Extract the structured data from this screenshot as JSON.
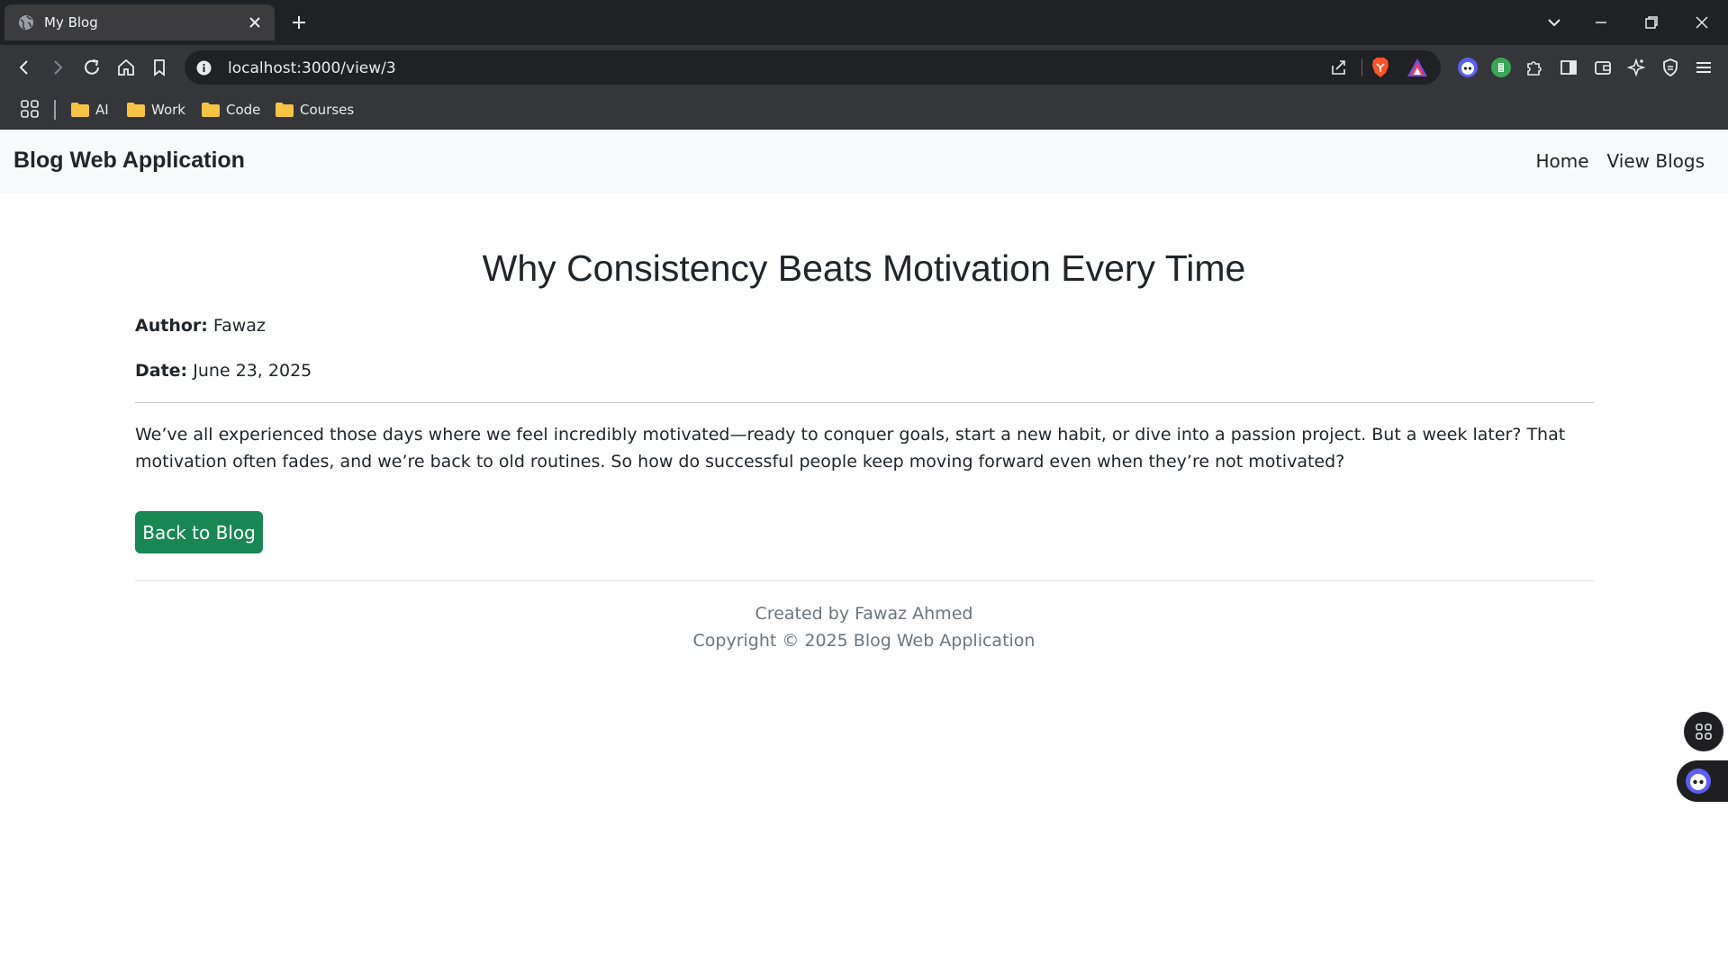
{
  "browser": {
    "tab_title": "My Blog",
    "url": "localhost:3000/view/3",
    "bookmarks": [
      "AI",
      "Work",
      "Code",
      "Courses"
    ]
  },
  "navbar": {
    "brand": "Blog Web Application",
    "links": [
      "Home",
      "View Blogs"
    ]
  },
  "post": {
    "title": "Why Consistency Beats Motivation Every Time",
    "author_label": "Author:",
    "author": "Fawaz",
    "date_label": "Date:",
    "date": "June 23, 2025",
    "content": "We’ve all experienced those days where we feel incredibly motivated—ready to conquer goals, start a new habit, or dive into a passion project. But a week later? That motivation often fades, and we’re back to old routines. So how do successful people keep moving forward even when they’re not motivated?",
    "back_button": "Back to Blog"
  },
  "footer": {
    "created_by": "Created by Fawaz Ahmed",
    "copyright": "Copyright © 2025 Blog Web Application"
  },
  "colors": {
    "button_green": "#198754",
    "navbar_bg": "#f8f9fa",
    "browser_dark": "#202124"
  }
}
